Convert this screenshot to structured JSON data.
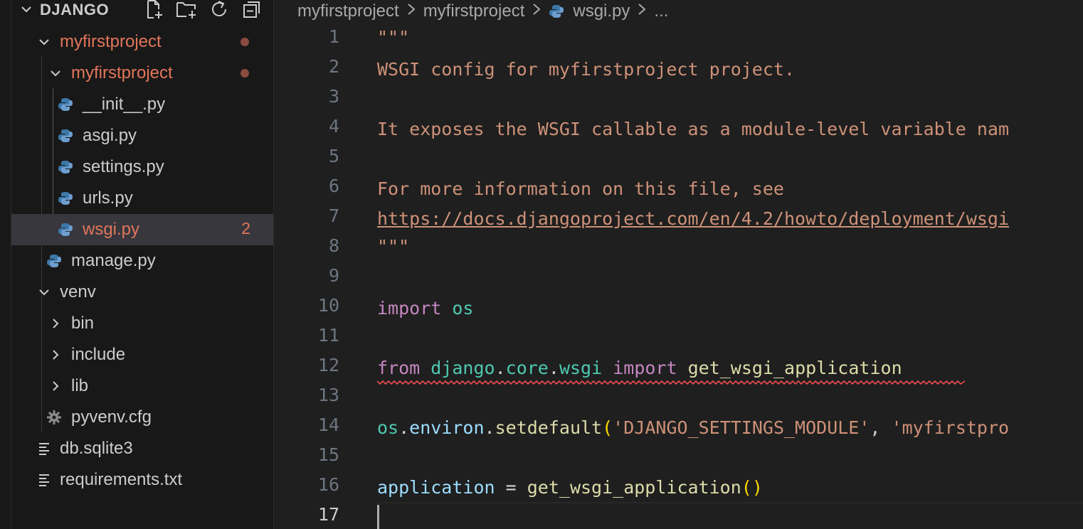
{
  "explorer": {
    "title": "DJANGO",
    "actions": [
      "new-file",
      "new-folder",
      "refresh",
      "collapse-all"
    ],
    "items": [
      {
        "label": "myfirstproject",
        "type": "folder",
        "expanded": true,
        "modified": true
      },
      {
        "label": "myfirstproject",
        "type": "folder",
        "expanded": true,
        "modified": true
      },
      {
        "label": "__init__.py",
        "type": "python"
      },
      {
        "label": "asgi.py",
        "type": "python"
      },
      {
        "label": "settings.py",
        "type": "python"
      },
      {
        "label": "urls.py",
        "type": "python"
      },
      {
        "label": "wsgi.py",
        "type": "python",
        "selected": true,
        "modified": true,
        "badge": "2"
      },
      {
        "label": "manage.py",
        "type": "python"
      },
      {
        "label": "venv",
        "type": "folder",
        "expanded": true
      },
      {
        "label": "bin",
        "type": "folder",
        "expanded": false
      },
      {
        "label": "include",
        "type": "folder",
        "expanded": false
      },
      {
        "label": "lib",
        "type": "folder",
        "expanded": false
      },
      {
        "label": "pyvenv.cfg",
        "type": "config"
      },
      {
        "label": "db.sqlite3",
        "type": "text"
      },
      {
        "label": "requirements.txt",
        "type": "text"
      }
    ]
  },
  "breadcrumb": {
    "parts": [
      "myfirstproject",
      "myfirstproject",
      "wsgi.py",
      "..."
    ]
  },
  "editor": {
    "line_numbers": [
      "1",
      "2",
      "3",
      "4",
      "5",
      "6",
      "7",
      "8",
      "9",
      "10",
      "11",
      "12",
      "13",
      "14",
      "15",
      "16",
      "17"
    ],
    "active_line": "17",
    "lines": {
      "l1": "\"\"\"",
      "l2": "WSGI config for myfirstproject project.",
      "l4": "It exposes the WSGI callable as a module-level variable nam",
      "l6": "For more information on this file, see",
      "l7": "https://docs.djangoproject.com/en/4.2/howto/deployment/wsgi",
      "l8": "\"\"\"",
      "l10_kw": "import",
      "l10_mod": "os",
      "l12_from": "from",
      "l12_m1": "django",
      "l12_d1": ".",
      "l12_m2": "core",
      "l12_d2": ".",
      "l12_m3": "wsgi",
      "l12_imp": "import",
      "l12_fn": "get_wsgi_application",
      "l14_mod": "os",
      "l14_d1": ".",
      "l14_attr": "environ",
      "l14_d2": ".",
      "l14_fn": "setdefault",
      "l14_p": "(",
      "l14_s1": "'DJANGO_SETTINGS_MODULE'",
      "l14_comma": ", ",
      "l14_s2": "'myfirstpro",
      "l16_var": "application",
      "l16_eq": " = ",
      "l16_fn": "get_wsgi_application",
      "l16_p": "()"
    }
  },
  "colors": {
    "modified": "#e2765a",
    "error_squiggle": "#f14c4c",
    "string": "#ce9178",
    "keyword": "#c586c0",
    "module": "#4ec9b0",
    "function": "#dcdcaa",
    "variable": "#9cdcfe"
  }
}
